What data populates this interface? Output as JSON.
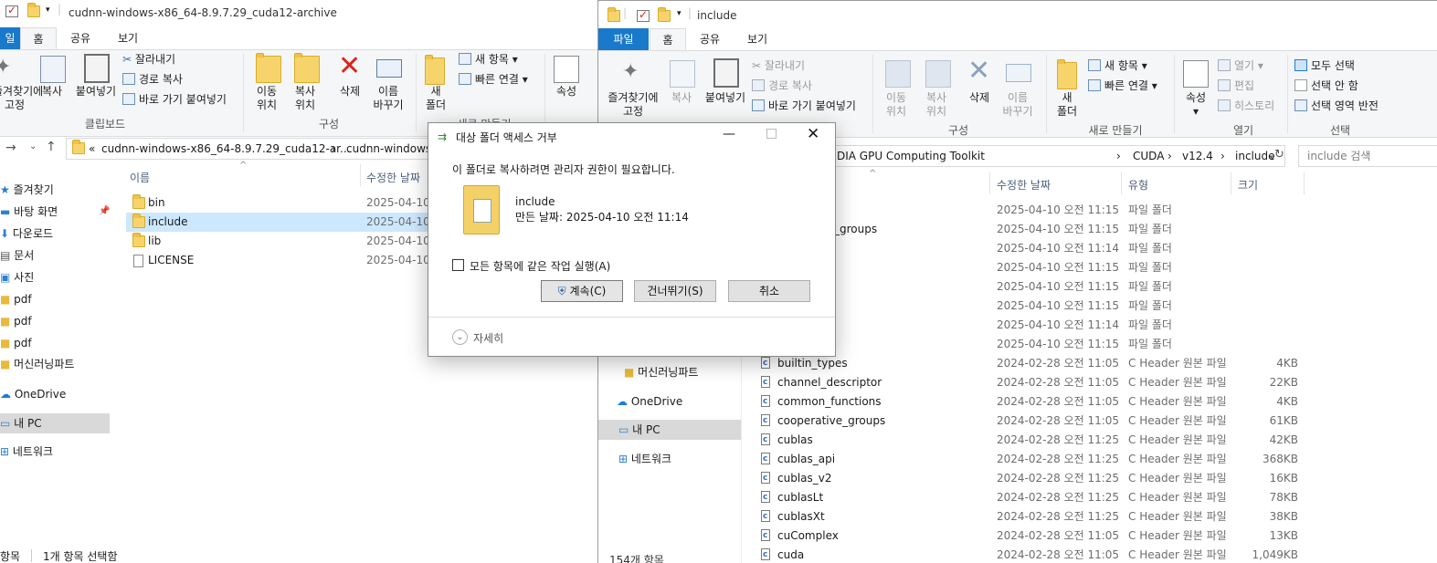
{
  "left_window": {
    "title": "cudnn-windows-x86_64-8.9.7.29_cuda12-archive",
    "tabs": [
      "일",
      "홈",
      "공유",
      "보기"
    ],
    "ribbon": {
      "pin": "즐겨찾기에\n고정",
      "copy": "복사",
      "paste": "붙여넣기",
      "cut": "잘라내기",
      "copy_path": "경로 복사",
      "paste_shortcut": "바로 가기 붙여넣기",
      "move_to": "이동\n위치",
      "copy_to": "복사\n위치",
      "delete": "삭제",
      "rename": "이름\n바꾸기",
      "new_folder": "새\n폴더",
      "new_item": "새 항목",
      "easy_access": "빠른 연결",
      "properties": "속성",
      "group_clipboard": "클립보드",
      "group_organize": "구성",
      "group_new": "새로 만들기"
    },
    "address": {
      "prefix": "«",
      "part1": "cudnn-windows-x86_64-8.9.7.29_cuda12-ar...",
      "sep": "›",
      "part2": "cudnn-windows-"
    },
    "columns": {
      "name": "이름",
      "modified": "수정한 날짜"
    },
    "nav": [
      {
        "label": "즐겨찾기"
      },
      {
        "label": "바탕 화면"
      },
      {
        "label": "다운로드"
      },
      {
        "label": "문서"
      },
      {
        "label": "사진"
      },
      {
        "label": "pdf"
      },
      {
        "label": "pdf"
      },
      {
        "label": "pdf"
      },
      {
        "label": "머신러닝파트"
      },
      {
        "label": "OneDrive"
      },
      {
        "label": "내 PC"
      },
      {
        "label": "네트워크"
      }
    ],
    "files": [
      {
        "name": "bin",
        "date": "2025-04-10"
      },
      {
        "name": "include",
        "date": "2025-04-10"
      },
      {
        "name": "lib",
        "date": "2025-04-10"
      },
      {
        "name": "LICENSE",
        "date": "2025-04-10"
      }
    ],
    "status": {
      "count": "항목",
      "selected": "1개 항목 선택함"
    }
  },
  "right_window": {
    "title": "include",
    "tabs": [
      "파일",
      "홈",
      "공유",
      "보기"
    ],
    "ribbon": {
      "pin": "즐겨찾기에\n고정",
      "copy": "복사",
      "paste": "붙여넣기",
      "cut": "잘라내기",
      "copy_path": "경로 복사",
      "paste_shortcut": "바로 가기 붙여넣기",
      "move_to": "이동\n위치",
      "copy_to": "복사\n위치",
      "delete": "삭제",
      "rename": "이름\n바꾸기",
      "new_folder": "새\n폴더",
      "new_item": "새 항목",
      "easy_access": "빠른 연결",
      "properties": "속성",
      "open": "열기",
      "edit": "편집",
      "history": "히스토리",
      "select_all": "모두 선택",
      "select_none": "선택 안 함",
      "invert_selection": "선택 영역 반전",
      "group_organize": "구성",
      "group_new": "새로 만들기",
      "group_open": "열기",
      "group_select": "선택"
    },
    "address": {
      "part1": "DIA GPU Computing Toolkit",
      "part2": "CUDA",
      "part3": "v12.4",
      "part4": "include",
      "sep": "›"
    },
    "search_placeholder": "include 검색",
    "columns": {
      "modified": "수정한 날짜",
      "type": "유형",
      "size": "크기"
    },
    "nav": [
      {
        "label": "머신러닝파트"
      },
      {
        "label": "OneDrive"
      },
      {
        "label": "내 PC"
      },
      {
        "label": "네트워크"
      }
    ],
    "rows": [
      {
        "name": "",
        "date": "2025-04-10 오전 11:15",
        "type": "파일 폴더",
        "size": ""
      },
      {
        "name": "_groups",
        "date": "2025-04-10 오전 11:15",
        "type": "파일 폴더",
        "size": ""
      },
      {
        "name": "",
        "date": "2025-04-10 오전 11:14",
        "type": "파일 폴더",
        "size": ""
      },
      {
        "name": "",
        "date": "2025-04-10 오전 11:15",
        "type": "파일 폴더",
        "size": ""
      },
      {
        "name": "",
        "date": "2025-04-10 오전 11:15",
        "type": "파일 폴더",
        "size": ""
      },
      {
        "name": "",
        "date": "2025-04-10 오전 11:15",
        "type": "파일 폴더",
        "size": ""
      },
      {
        "name": "",
        "date": "2025-04-10 오전 11:14",
        "type": "파일 폴더",
        "size": ""
      },
      {
        "name": "",
        "date": "2025-04-10 오전 11:15",
        "type": "파일 폴더",
        "size": ""
      },
      {
        "name": "builtin_types",
        "date": "2024-02-28 오전 11:05",
        "type": "C Header 원본 파일",
        "size": "4KB"
      },
      {
        "name": "channel_descriptor",
        "date": "2024-02-28 오전 11:05",
        "type": "C Header 원본 파일",
        "size": "22KB"
      },
      {
        "name": "common_functions",
        "date": "2024-02-28 오전 11:05",
        "type": "C Header 원본 파일",
        "size": "4KB"
      },
      {
        "name": "cooperative_groups",
        "date": "2024-02-28 오전 11:05",
        "type": "C Header 원본 파일",
        "size": "61KB"
      },
      {
        "name": "cublas",
        "date": "2024-02-28 오전 11:25",
        "type": "C Header 원본 파일",
        "size": "42KB"
      },
      {
        "name": "cublas_api",
        "date": "2024-02-28 오전 11:25",
        "type": "C Header 원본 파일",
        "size": "368KB"
      },
      {
        "name": "cublas_v2",
        "date": "2024-02-28 오전 11:25",
        "type": "C Header 원본 파일",
        "size": "16KB"
      },
      {
        "name": "cublasLt",
        "date": "2024-02-28 오전 11:25",
        "type": "C Header 원본 파일",
        "size": "78KB"
      },
      {
        "name": "cublasXt",
        "date": "2024-02-28 오전 11:25",
        "type": "C Header 원본 파일",
        "size": "38KB"
      },
      {
        "name": "cuComplex",
        "date": "2024-02-28 오전 11:05",
        "type": "C Header 원본 파일",
        "size": "13KB"
      },
      {
        "name": "cuda",
        "date": "2024-02-28 오전 11:05",
        "type": "C Header 원본 파일",
        "size": "1,049KB"
      }
    ],
    "status": {
      "count": "154개 항목"
    }
  },
  "dialog": {
    "title": "대상 폴더 액세스 거부",
    "message": "이 폴더로 복사하려면 관리자 권한이 필요합니다.",
    "item_name": "include",
    "item_created": "만든 날짜: 2025-04-10 오전 11:14",
    "checkbox_label": "모든 항목에 같은 작업 실행(A)",
    "continue": "계속(C)",
    "skip": "건너뛰기(S)",
    "cancel": "취소",
    "details": "자세히"
  },
  "colors": {
    "file_tab": "#1979ca",
    "ribbon_bg": "#f5f6f7",
    "selection": "#cce8ff",
    "folder": "#f7d46b",
    "delete_red": "#d9251d"
  }
}
